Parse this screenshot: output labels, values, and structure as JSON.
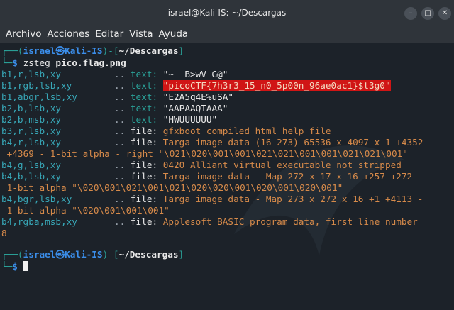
{
  "window": {
    "title": "israel@Kali-IS: ~/Descargas",
    "buttons": [
      "–",
      "□",
      "✕"
    ]
  },
  "menu": [
    "Archivo",
    "Acciones",
    "Editar",
    "Vista",
    "Ayuda"
  ],
  "prompt": {
    "corner_top": "┌──(",
    "user": "israel",
    "at": "㉿",
    "host": "Kali-IS",
    "mid": ")-[",
    "path": "~/Descargas",
    "end": "]",
    "corner_bottom": "└─",
    "dollar": "$"
  },
  "command": {
    "program": "zsteg",
    "arg": "pico.flag.png"
  },
  "output": [
    {
      "key": "b1,r,lsb,xy",
      "sep": "..",
      "type": "text:",
      "value": "\"~__B>wV_G@\""
    },
    {
      "key": "b1,rgb,lsb,xy",
      "sep": "..",
      "type": "text:",
      "value": "\"picoCTF{7h3r3_15_n0_5p00n_96ae0ac1}$t3g0\"",
      "highlight": true
    },
    {
      "key": "b1,abgr,lsb,xy",
      "sep": "..",
      "type": "text:",
      "value": "\"E2A5q4E%uSA\""
    },
    {
      "key": "b2,b,lsb,xy",
      "sep": "..",
      "type": "text:",
      "value": "\"AAPAAQTAAA\""
    },
    {
      "key": "b2,b,msb,xy",
      "sep": "..",
      "type": "text:",
      "value": "\"HWUUUUUU\""
    },
    {
      "key": "b3,r,lsb,xy",
      "sep": "..",
      "type": "file:",
      "value": "gfxboot compiled html help file"
    },
    {
      "key": "b4,r,lsb,xy",
      "sep": "..",
      "type": "file:",
      "value": "Targa image data (16-273) 65536 x 4097 x 1 +4352",
      "cont": " +4369 - 1-bit alpha - right \"\\021\\020\\001\\001\\021\\021\\001\\001\\021\\021\\001\""
    },
    {
      "key": "b4,g,lsb,xy",
      "sep": "..",
      "type": "file:",
      "value": "0420 Alliant virtual executable not stripped"
    },
    {
      "key": "b4,b,lsb,xy",
      "sep": "..",
      "type": "file:",
      "value": "Targa image data - Map 272 x 17 x 16 +257 +272 -",
      "cont": " 1-bit alpha \"\\020\\001\\021\\001\\021\\020\\020\\001\\020\\001\\020\\001\""
    },
    {
      "key": "b4,bgr,lsb,xy",
      "sep": "..",
      "type": "file:",
      "value": "Targa image data - Map 273 x 272 x 16 +1 +4113 -",
      "cont": " 1-bit alpha \"\\020\\001\\001\\001\""
    },
    {
      "key": "b4,rgba,msb,xy",
      "sep": "..",
      "type": "file:",
      "value": "Applesoft BASIC program data, first line number",
      "cont": "8"
    }
  ]
}
